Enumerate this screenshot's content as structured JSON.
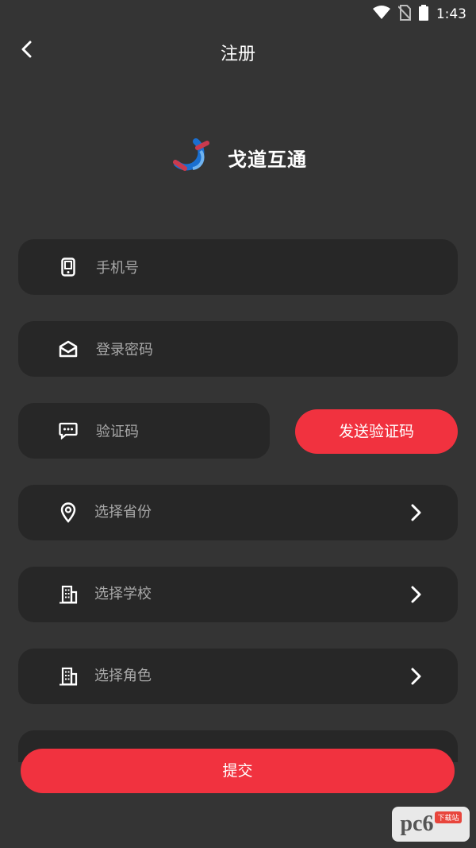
{
  "status_bar": {
    "time": "1:43",
    "icons": [
      "wifi-icon",
      "no-sim-icon",
      "battery-icon"
    ]
  },
  "header": {
    "title": "注册",
    "back_icon": "chevron-left-icon"
  },
  "logo": {
    "app_name": "戈道互通"
  },
  "form": {
    "phone": {
      "placeholder": "手机号",
      "icon": "phone-icon"
    },
    "password": {
      "placeholder": "登录密码",
      "icon": "envelope-icon"
    },
    "code": {
      "placeholder": "验证码",
      "icon": "message-icon"
    },
    "send_code_label": "发送验证码",
    "province": {
      "label": "选择省份",
      "icon": "location-pin-icon"
    },
    "school": {
      "label": "选择学校",
      "icon": "building-icon"
    },
    "role": {
      "label": "选择角色",
      "icon": "building-icon"
    }
  },
  "submit_label": "提交",
  "watermark": {
    "text": "pc6",
    "badge": "下载站"
  },
  "colors": {
    "background": "#343434",
    "field": "#272727",
    "accent": "#f1323f"
  }
}
